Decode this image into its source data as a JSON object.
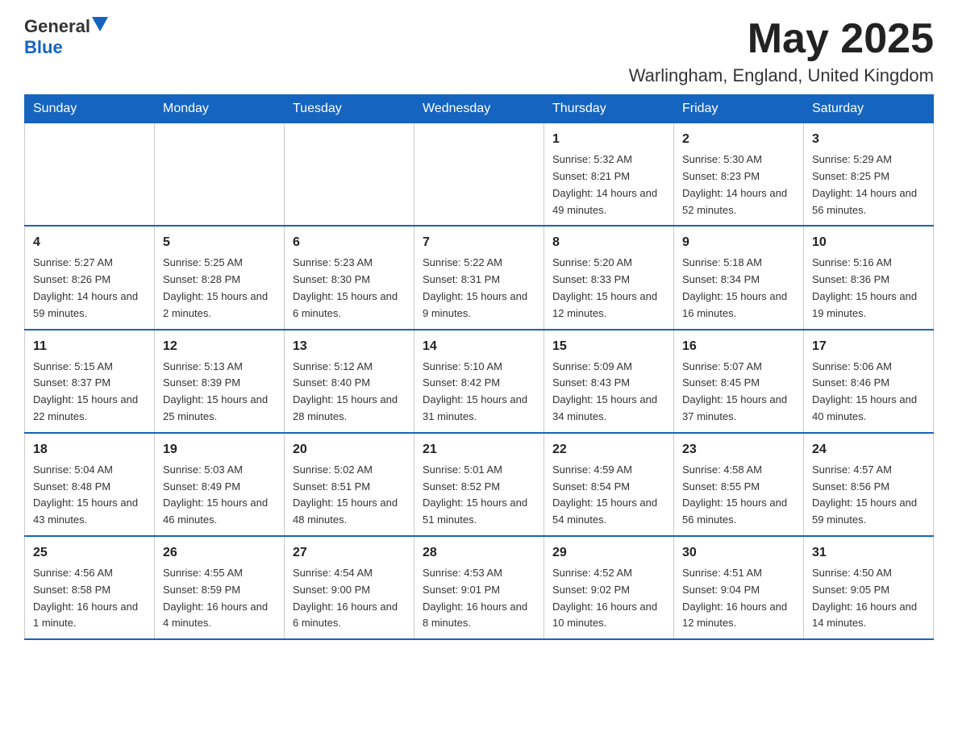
{
  "logo": {
    "general": "General",
    "blue": "Blue"
  },
  "header": {
    "month": "May 2025",
    "location": "Warlingham, England, United Kingdom"
  },
  "weekdays": [
    "Sunday",
    "Monday",
    "Tuesday",
    "Wednesday",
    "Thursday",
    "Friday",
    "Saturday"
  ],
  "weeks": [
    [
      {
        "day": "",
        "info": ""
      },
      {
        "day": "",
        "info": ""
      },
      {
        "day": "",
        "info": ""
      },
      {
        "day": "",
        "info": ""
      },
      {
        "day": "1",
        "info": "Sunrise: 5:32 AM\nSunset: 8:21 PM\nDaylight: 14 hours and 49 minutes."
      },
      {
        "day": "2",
        "info": "Sunrise: 5:30 AM\nSunset: 8:23 PM\nDaylight: 14 hours and 52 minutes."
      },
      {
        "day": "3",
        "info": "Sunrise: 5:29 AM\nSunset: 8:25 PM\nDaylight: 14 hours and 56 minutes."
      }
    ],
    [
      {
        "day": "4",
        "info": "Sunrise: 5:27 AM\nSunset: 8:26 PM\nDaylight: 14 hours and 59 minutes."
      },
      {
        "day": "5",
        "info": "Sunrise: 5:25 AM\nSunset: 8:28 PM\nDaylight: 15 hours and 2 minutes."
      },
      {
        "day": "6",
        "info": "Sunrise: 5:23 AM\nSunset: 8:30 PM\nDaylight: 15 hours and 6 minutes."
      },
      {
        "day": "7",
        "info": "Sunrise: 5:22 AM\nSunset: 8:31 PM\nDaylight: 15 hours and 9 minutes."
      },
      {
        "day": "8",
        "info": "Sunrise: 5:20 AM\nSunset: 8:33 PM\nDaylight: 15 hours and 12 minutes."
      },
      {
        "day": "9",
        "info": "Sunrise: 5:18 AM\nSunset: 8:34 PM\nDaylight: 15 hours and 16 minutes."
      },
      {
        "day": "10",
        "info": "Sunrise: 5:16 AM\nSunset: 8:36 PM\nDaylight: 15 hours and 19 minutes."
      }
    ],
    [
      {
        "day": "11",
        "info": "Sunrise: 5:15 AM\nSunset: 8:37 PM\nDaylight: 15 hours and 22 minutes."
      },
      {
        "day": "12",
        "info": "Sunrise: 5:13 AM\nSunset: 8:39 PM\nDaylight: 15 hours and 25 minutes."
      },
      {
        "day": "13",
        "info": "Sunrise: 5:12 AM\nSunset: 8:40 PM\nDaylight: 15 hours and 28 minutes."
      },
      {
        "day": "14",
        "info": "Sunrise: 5:10 AM\nSunset: 8:42 PM\nDaylight: 15 hours and 31 minutes."
      },
      {
        "day": "15",
        "info": "Sunrise: 5:09 AM\nSunset: 8:43 PM\nDaylight: 15 hours and 34 minutes."
      },
      {
        "day": "16",
        "info": "Sunrise: 5:07 AM\nSunset: 8:45 PM\nDaylight: 15 hours and 37 minutes."
      },
      {
        "day": "17",
        "info": "Sunrise: 5:06 AM\nSunset: 8:46 PM\nDaylight: 15 hours and 40 minutes."
      }
    ],
    [
      {
        "day": "18",
        "info": "Sunrise: 5:04 AM\nSunset: 8:48 PM\nDaylight: 15 hours and 43 minutes."
      },
      {
        "day": "19",
        "info": "Sunrise: 5:03 AM\nSunset: 8:49 PM\nDaylight: 15 hours and 46 minutes."
      },
      {
        "day": "20",
        "info": "Sunrise: 5:02 AM\nSunset: 8:51 PM\nDaylight: 15 hours and 48 minutes."
      },
      {
        "day": "21",
        "info": "Sunrise: 5:01 AM\nSunset: 8:52 PM\nDaylight: 15 hours and 51 minutes."
      },
      {
        "day": "22",
        "info": "Sunrise: 4:59 AM\nSunset: 8:54 PM\nDaylight: 15 hours and 54 minutes."
      },
      {
        "day": "23",
        "info": "Sunrise: 4:58 AM\nSunset: 8:55 PM\nDaylight: 15 hours and 56 minutes."
      },
      {
        "day": "24",
        "info": "Sunrise: 4:57 AM\nSunset: 8:56 PM\nDaylight: 15 hours and 59 minutes."
      }
    ],
    [
      {
        "day": "25",
        "info": "Sunrise: 4:56 AM\nSunset: 8:58 PM\nDaylight: 16 hours and 1 minute."
      },
      {
        "day": "26",
        "info": "Sunrise: 4:55 AM\nSunset: 8:59 PM\nDaylight: 16 hours and 4 minutes."
      },
      {
        "day": "27",
        "info": "Sunrise: 4:54 AM\nSunset: 9:00 PM\nDaylight: 16 hours and 6 minutes."
      },
      {
        "day": "28",
        "info": "Sunrise: 4:53 AM\nSunset: 9:01 PM\nDaylight: 16 hours and 8 minutes."
      },
      {
        "day": "29",
        "info": "Sunrise: 4:52 AM\nSunset: 9:02 PM\nDaylight: 16 hours and 10 minutes."
      },
      {
        "day": "30",
        "info": "Sunrise: 4:51 AM\nSunset: 9:04 PM\nDaylight: 16 hours and 12 minutes."
      },
      {
        "day": "31",
        "info": "Sunrise: 4:50 AM\nSunset: 9:05 PM\nDaylight: 16 hours and 14 minutes."
      }
    ]
  ]
}
